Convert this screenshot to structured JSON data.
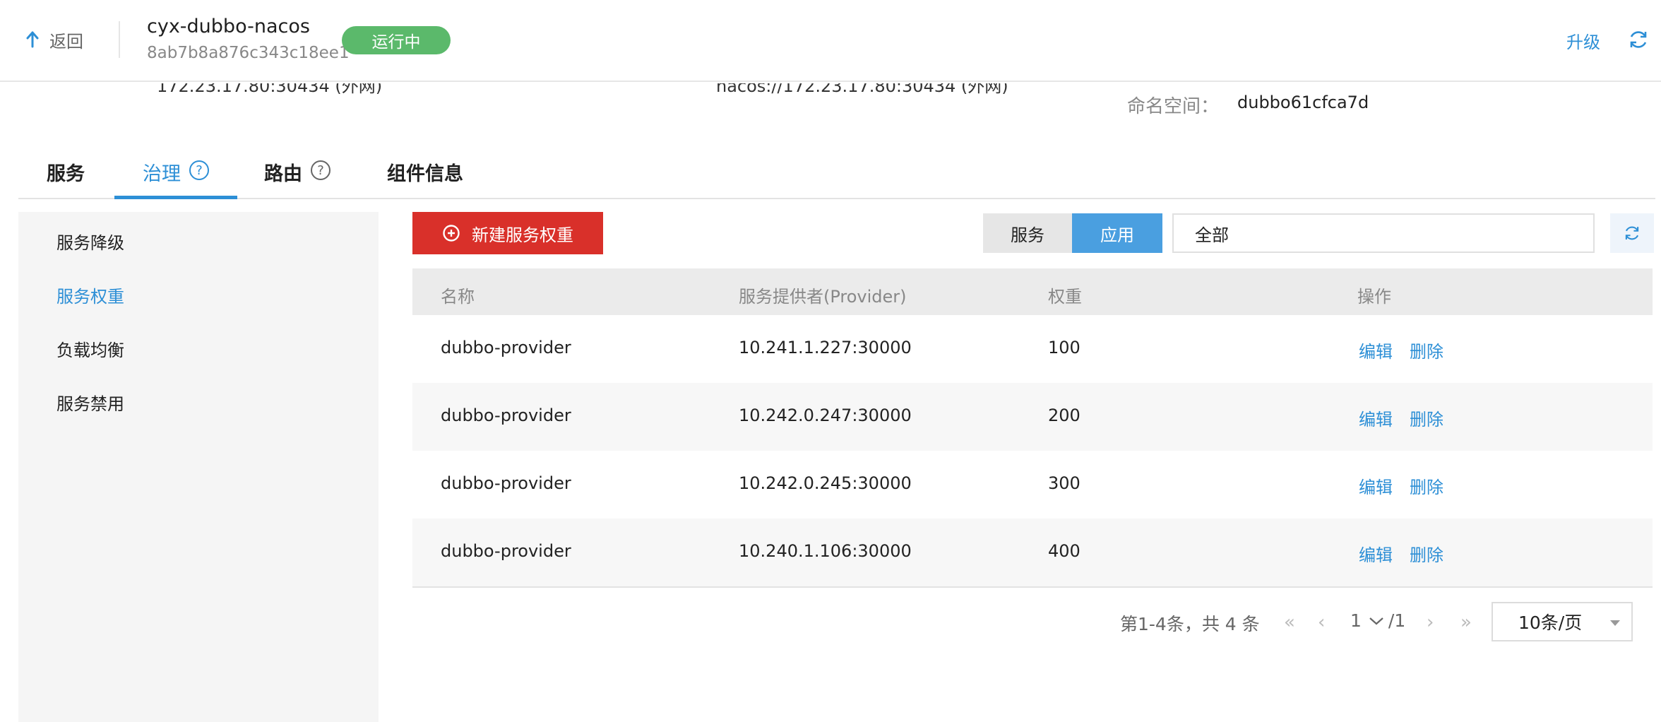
{
  "header": {
    "back_label": "返回",
    "instance_name": "cyx-dubbo-nacos",
    "instance_id": "8ab7b8a876c343c18ee1",
    "status": "运行中",
    "upgrade_label": "升级"
  },
  "info": {
    "left_address": "172.23.17.80:30434 (外网)",
    "middle_address": "nacos://172.23.17.80:30434 (外网)",
    "namespace_label": "命名空间：",
    "namespace_value": "dubbo61cfca7d"
  },
  "tabs": [
    {
      "label": "服务"
    },
    {
      "label": "治理",
      "help": "?"
    },
    {
      "label": "路由",
      "help": "?"
    },
    {
      "label": "组件信息"
    }
  ],
  "sidebar": {
    "items": [
      {
        "label": "服务降级"
      },
      {
        "label": "服务权重"
      },
      {
        "label": "负载均衡"
      },
      {
        "label": "服务禁用"
      }
    ]
  },
  "toolbar": {
    "new_button": "新建服务权重",
    "segment_service": "服务",
    "segment_app": "应用",
    "filter_value": "全部"
  },
  "table": {
    "headers": [
      "名称",
      "服务提供者(Provider)",
      "权重",
      "操作"
    ],
    "rows": [
      {
        "name": "dubbo-provider",
        "provider": "10.241.1.227:30000",
        "weight": "100",
        "edit": "编辑",
        "delete": "删除"
      },
      {
        "name": "dubbo-provider",
        "provider": "10.242.0.247:30000",
        "weight": "200",
        "edit": "编辑",
        "delete": "删除"
      },
      {
        "name": "dubbo-provider",
        "provider": "10.242.0.245:30000",
        "weight": "300",
        "edit": "编辑",
        "delete": "删除"
      },
      {
        "name": "dubbo-provider",
        "provider": "10.240.1.106:30000",
        "weight": "400",
        "edit": "编辑",
        "delete": "删除"
      }
    ]
  },
  "pagination": {
    "summary": "第1-4条，共 4 条",
    "first_icon": "«",
    "prev_icon": "‹",
    "current_page": "1",
    "total_pages": "/1",
    "next_icon": "›",
    "last_icon": "»",
    "page_size": "10条/页"
  },
  "colors": {
    "accent": "#2d8fd6",
    "primary_button": "#d9302a",
    "status_running": "#5bb96b"
  }
}
